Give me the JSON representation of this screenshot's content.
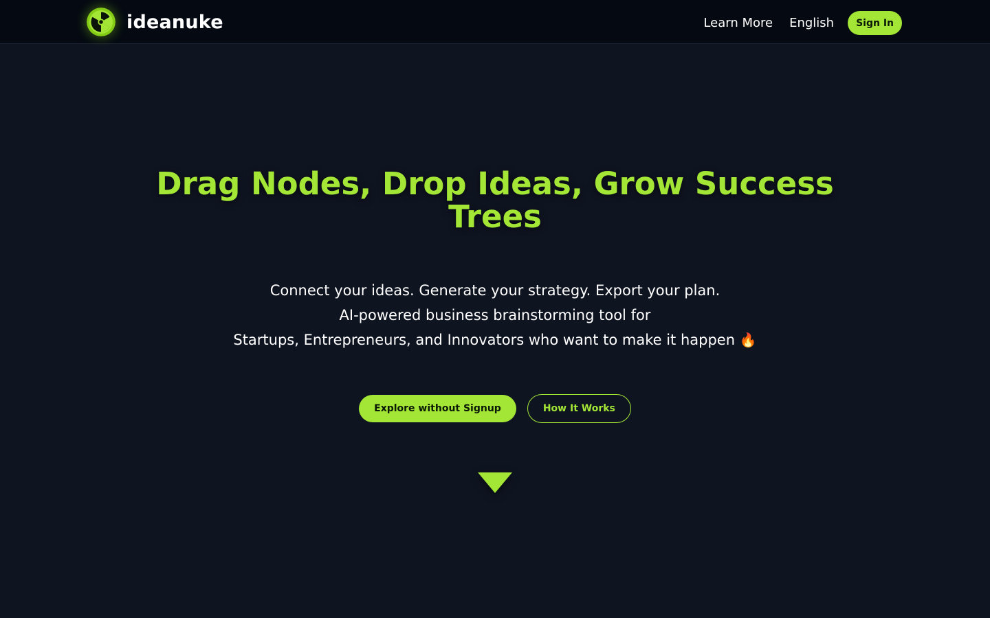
{
  "brand": {
    "name": "ideanuke",
    "logo_icon": "radiation-icon",
    "accent_color": "#a3e635"
  },
  "nav": {
    "learn_more": "Learn More",
    "language": "English",
    "sign_in": "Sign In"
  },
  "hero": {
    "title": "Drag Nodes, Drop Ideas, Grow Success Trees",
    "subtitle_lines": [
      "Connect your ideas. Generate your strategy. Export your plan.",
      "AI-powered business brainstorming tool for",
      "Startups, Entrepreneurs, and Innovators who want to make it happen"
    ],
    "subtitle_emoji": "🔥",
    "primary_cta": "Explore without Signup",
    "secondary_cta": "How It Works",
    "scroll_icon": "triangle-down-icon"
  },
  "colors": {
    "nav_bg": "#050a12",
    "page_bg": "#0f1421",
    "accent": "#a3e635",
    "text": "#ffffff"
  }
}
